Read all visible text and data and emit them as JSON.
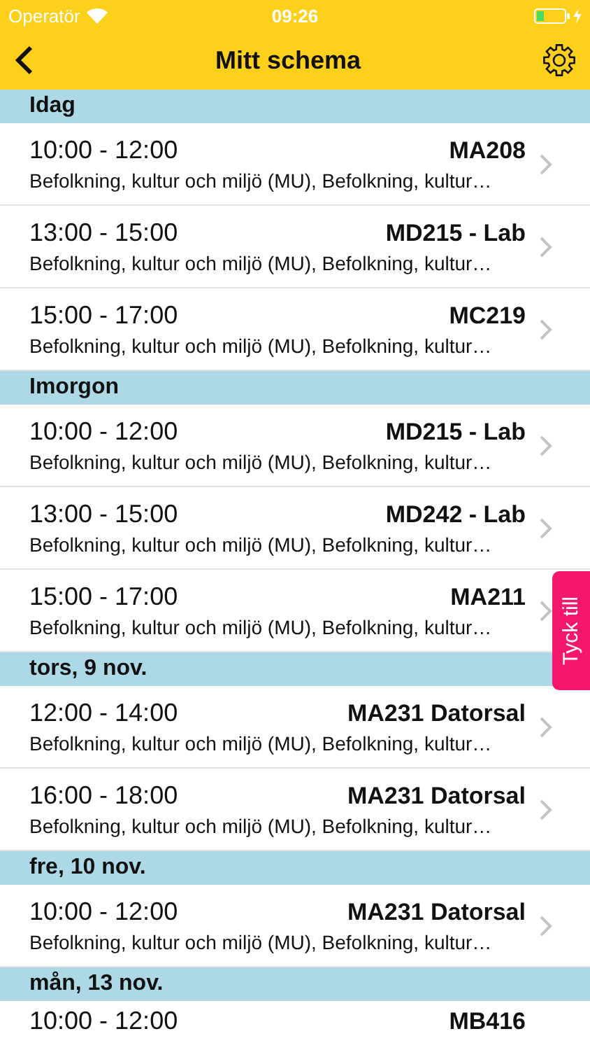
{
  "status_bar": {
    "carrier": "Operatör",
    "time": "09:26"
  },
  "nav": {
    "title": "Mitt schema"
  },
  "sections": [
    {
      "title": "Idag",
      "rows": [
        {
          "time": "10:00 - 12:00",
          "room": "MA208",
          "description": "Befolkning, kultur och miljö (MU), Befolkning, kultur…"
        },
        {
          "time": "13:00 - 15:00",
          "room": "MD215 - Lab",
          "description": "Befolkning, kultur och miljö (MU), Befolkning, kultur…"
        },
        {
          "time": "15:00 - 17:00",
          "room": "MC219",
          "description": "Befolkning, kultur och miljö (MU), Befolkning, kultur…"
        }
      ]
    },
    {
      "title": "Imorgon",
      "rows": [
        {
          "time": "10:00 - 12:00",
          "room": "MD215 - Lab",
          "description": "Befolkning, kultur och miljö (MU), Befolkning, kultur…"
        },
        {
          "time": "13:00 - 15:00",
          "room": "MD242 - Lab",
          "description": "Befolkning, kultur och miljö (MU), Befolkning, kultur…"
        },
        {
          "time": "15:00 - 17:00",
          "room": "MA211",
          "description": "Befolkning, kultur och miljö (MU), Befolkning, kultur…"
        }
      ]
    },
    {
      "title": "tors, 9 nov.",
      "rows": [
        {
          "time": "12:00 - 14:00",
          "room": "MA231 Datorsal",
          "description": "Befolkning, kultur och miljö (MU), Befolkning, kultur…"
        },
        {
          "time": "16:00 - 18:00",
          "room": "MA231 Datorsal",
          "description": "Befolkning, kultur och miljö (MU), Befolkning, kultur…"
        }
      ]
    },
    {
      "title": "fre, 10 nov.",
      "rows": [
        {
          "time": "10:00 - 12:00",
          "room": "MA231 Datorsal",
          "description": "Befolkning, kultur och miljö (MU), Befolkning, kultur…"
        }
      ]
    },
    {
      "title": "mån, 13 nov.",
      "rows": [
        {
          "time": "10:00 - 12:00",
          "room": "MB416"
        }
      ]
    }
  ],
  "feedback_tab": {
    "label": "Tyck till"
  }
}
